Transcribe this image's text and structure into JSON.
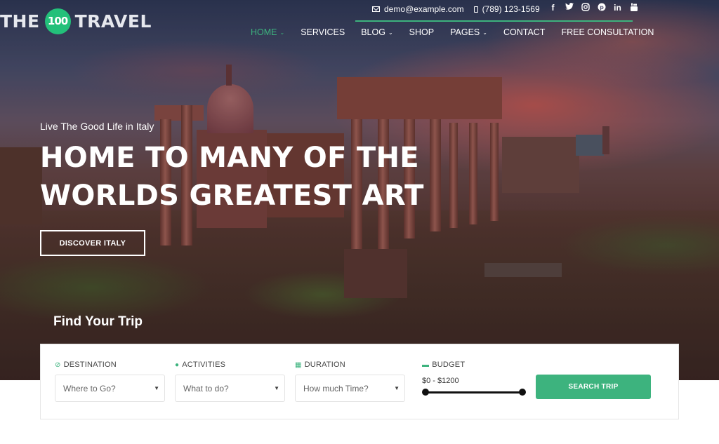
{
  "brand": {
    "prefix": "THE",
    "badge": "100",
    "suffix": "TRAVEL"
  },
  "topbar": {
    "email": "demo@example.com",
    "phone": "(789) 123-1569",
    "social": [
      {
        "name": "facebook-icon",
        "glyph": "f"
      },
      {
        "name": "twitter-icon",
        "glyph": "🐦"
      },
      {
        "name": "instagram-icon",
        "glyph": "◎"
      },
      {
        "name": "pinterest-icon",
        "glyph": "℗"
      },
      {
        "name": "linkedin-icon",
        "glyph": "in"
      },
      {
        "name": "youtube-icon",
        "glyph": "▣"
      }
    ]
  },
  "nav": {
    "items": [
      {
        "label": "HOME",
        "dropdown": true,
        "active": true
      },
      {
        "label": "SERVICES",
        "dropdown": false
      },
      {
        "label": "BLOG",
        "dropdown": true
      },
      {
        "label": "SHOP",
        "dropdown": false
      },
      {
        "label": "PAGES",
        "dropdown": true
      },
      {
        "label": "CONTACT",
        "dropdown": false
      },
      {
        "label": "FREE CONSULTATION",
        "dropdown": false
      }
    ],
    "chevron": "⌄"
  },
  "hero": {
    "kicker": "Live The Good Life in Italy",
    "headline_line1": "HOME TO MANY OF THE",
    "headline_line2": "WORLDS GREATEST ART",
    "cta": "DISCOVER ITALY"
  },
  "search": {
    "title": "Find Your Trip",
    "fields": [
      {
        "label": "DESTINATION",
        "icon": "⊘",
        "placeholder": "Where to Go?"
      },
      {
        "label": "ACTIVITIES",
        "icon": "●",
        "placeholder": "What to do?"
      },
      {
        "label": "DURATION",
        "icon": "▦",
        "placeholder": "How much Time?"
      }
    ],
    "budget": {
      "label": "BUDGET",
      "icon": "▬",
      "value": "$0 - $1200",
      "min_fraction": 0,
      "max_fraction": 1
    },
    "caret": "▼",
    "button": "SEARCH TRIP"
  },
  "colors": {
    "accent": "#3db37e",
    "logo_badge": "#23c07a"
  }
}
